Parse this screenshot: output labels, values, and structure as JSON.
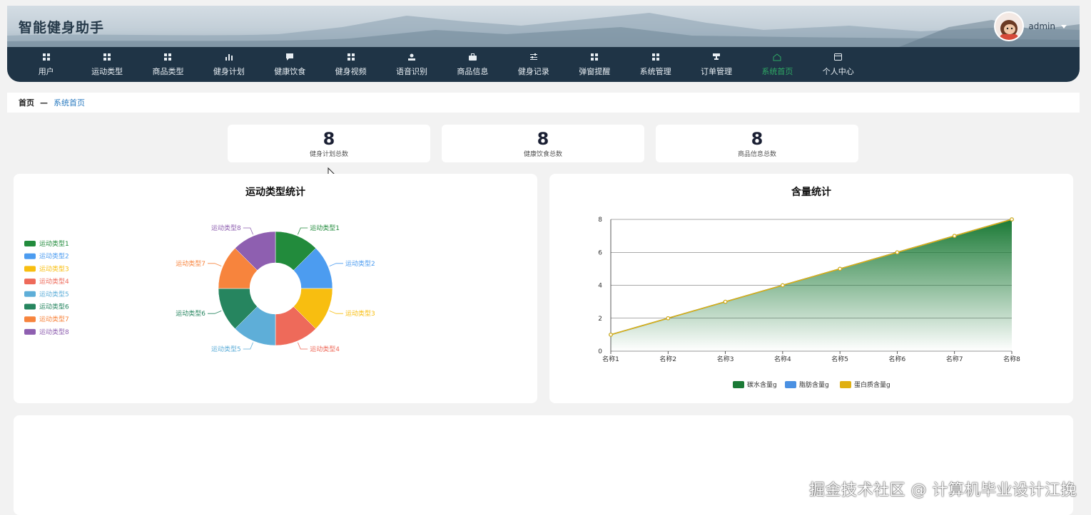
{
  "app": {
    "title": "智能健身助手"
  },
  "user": {
    "name": "admin"
  },
  "nav": [
    {
      "label": "用户",
      "icon": "grid-icon"
    },
    {
      "label": "运动类型",
      "icon": "grid-icon"
    },
    {
      "label": "商品类型",
      "icon": "grid-icon"
    },
    {
      "label": "健身计划",
      "icon": "bar-chart-icon"
    },
    {
      "label": "健康饮食",
      "icon": "chat-icon"
    },
    {
      "label": "健身视频",
      "icon": "grid-icon"
    },
    {
      "label": "语音识别",
      "icon": "user-icon"
    },
    {
      "label": "商品信息",
      "icon": "briefcase-icon"
    },
    {
      "label": "健身记录",
      "icon": "sliders-icon"
    },
    {
      "label": "弹窗提醒",
      "icon": "grid-icon"
    },
    {
      "label": "系统管理",
      "icon": "grid-icon"
    },
    {
      "label": "订单管理",
      "icon": "trophy-icon"
    },
    {
      "label": "系统首页",
      "icon": "home-icon",
      "active": true
    },
    {
      "label": "个人中心",
      "icon": "card-icon"
    }
  ],
  "breadcrumb": {
    "home": "首页",
    "sep": "—",
    "current": "系统首页"
  },
  "stats": [
    {
      "value": "8",
      "label": "健身计划总数"
    },
    {
      "value": "8",
      "label": "健康饮食总数"
    },
    {
      "value": "8",
      "label": "商品信息总数"
    }
  ],
  "colors": {
    "accent_green": "#2ea864",
    "nav_bg": "#1f3446"
  },
  "chart_data": [
    {
      "type": "pie",
      "title": "运动类型统计",
      "donut": true,
      "legend_position": "left",
      "categories": [
        "运动类型1",
        "运动类型2",
        "运动类型3",
        "运动类型4",
        "运动类型5",
        "运动类型6",
        "运动类型7",
        "运动类型8"
      ],
      "values": [
        1,
        1,
        1,
        1,
        1,
        1,
        1,
        1
      ],
      "colors": [
        "#228b3c",
        "#4c9cf0",
        "#f8be10",
        "#ee6a5a",
        "#5eaed8",
        "#26855f",
        "#f7843d",
        "#8e5fb0"
      ]
    },
    {
      "type": "area",
      "title": "含量统计",
      "categories": [
        "名称1",
        "名称2",
        "名称3",
        "名称4",
        "名称5",
        "名称6",
        "名称7",
        "名称8"
      ],
      "ylim": [
        0,
        8
      ],
      "yticks": [
        0,
        2,
        4,
        6,
        8
      ],
      "grid": true,
      "legend_position": "bottom",
      "series": [
        {
          "name": "碳水含量g",
          "color": "#1b7a36",
          "values": [
            1,
            2,
            3,
            4,
            5,
            6,
            7,
            8
          ],
          "fill": true
        },
        {
          "name": "脂肪含量g",
          "color": "#4a90e2",
          "values": [
            1,
            2,
            3,
            4,
            5,
            6,
            7,
            8
          ]
        },
        {
          "name": "蛋白质含量g",
          "color": "#e0b012",
          "values": [
            1,
            2,
            3,
            4,
            5,
            6,
            7,
            8
          ]
        }
      ]
    }
  ],
  "watermark": "掘金技术社区 @ 计算机毕业设计江挽"
}
